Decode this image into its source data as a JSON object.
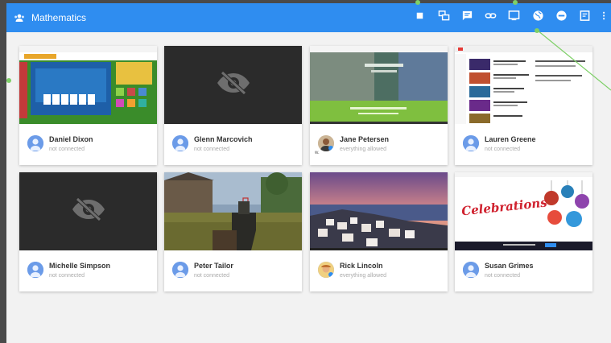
{
  "app": {
    "title": "Mathematics",
    "icon": "class-icon"
  },
  "toolbar": [
    {
      "icon": "stop-icon"
    },
    {
      "icon": "share-screen-icon"
    },
    {
      "icon": "message-icon"
    },
    {
      "icon": "link-icon"
    },
    {
      "icon": "presentation-icon"
    },
    {
      "icon": "web-filter-icon"
    },
    {
      "icon": "block-icon"
    },
    {
      "icon": "report-icon"
    },
    {
      "icon": "more-icon"
    }
  ],
  "students": [
    {
      "name": "Daniel Dixon",
      "status": "not connected",
      "screen": "game"
    },
    {
      "name": "Glenn Marcovich",
      "status": "not connected",
      "screen": "hidden"
    },
    {
      "name": "Jane Petersen",
      "status": "everything allowed",
      "screen": "website",
      "mark": "w."
    },
    {
      "name": "Lauren Greene",
      "status": "not connected",
      "screen": "video-site"
    },
    {
      "name": "Michelle Simpson",
      "status": "not connected",
      "screen": "hidden"
    },
    {
      "name": "Peter Tailor",
      "status": "not connected",
      "screen": "shooter"
    },
    {
      "name": "Rick Lincoln",
      "status": "everything allowed",
      "screen": "landscape"
    },
    {
      "name": "Susan Grimes",
      "status": "not connected",
      "screen": "celebrations",
      "banner": "Celebrations"
    }
  ],
  "colors": {
    "topbar": "#2f8df0",
    "background": "#f2f2f2",
    "hidden_screen": "#2b2b2b",
    "annotation": "#7ed068"
  }
}
